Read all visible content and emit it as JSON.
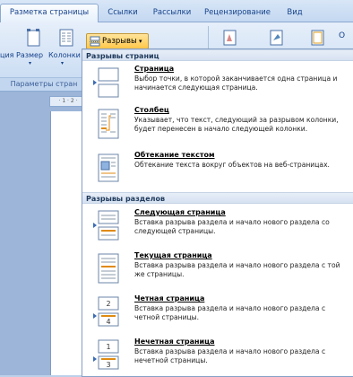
{
  "tabs": [
    {
      "label": "Разметка страницы",
      "active": true
    },
    {
      "label": "Ссылки",
      "active": false
    },
    {
      "label": "Рассылки",
      "active": false
    },
    {
      "label": "Рецензирование",
      "active": false
    },
    {
      "label": "Вид",
      "active": false
    }
  ],
  "ribbon": {
    "btn_orientation": "ция",
    "btn_size": "Размер",
    "btn_columns": "Колонки",
    "group_label": "Параметры стран",
    "breaks_label": "Разрывы",
    "breaks_arrow": "▾",
    "overflow_letter": "О"
  },
  "ruler": {
    "label": "· 1 · 2 ·"
  },
  "menu": {
    "page_breaks_header": "Разрывы страниц",
    "page_breaks": [
      {
        "title": "Страница",
        "desc": "Выбор точки, в которой заканчивается одна страница и начинается следующая страница."
      },
      {
        "title": "Столбец",
        "desc": "Указывает, что текст, следующий за разрывом колонки, будет перенесен в начало следующей колонки."
      },
      {
        "title": "Обтекание текстом",
        "desc": "Обтекание текста вокруг объектов на веб-страницах."
      }
    ],
    "section_breaks_header": "Разрывы разделов",
    "section_breaks": [
      {
        "title": "Следующая страница",
        "desc": "Вставка разрыва раздела и начало нового раздела со следующей страницы."
      },
      {
        "title": "Текущая страница",
        "desc": "Вставка разрыва раздела и начало нового раздела с той же страницы."
      },
      {
        "title": "Четная страница",
        "desc": "Вставка разрыва раздела и начало нового раздела с четной страницы."
      },
      {
        "title": "Нечетная страница",
        "desc": "Вставка разрыва раздела и начало нового раздела с нечетной страницы."
      }
    ],
    "section_icon_labels": [
      "2",
      "4",
      "1",
      "3"
    ]
  }
}
